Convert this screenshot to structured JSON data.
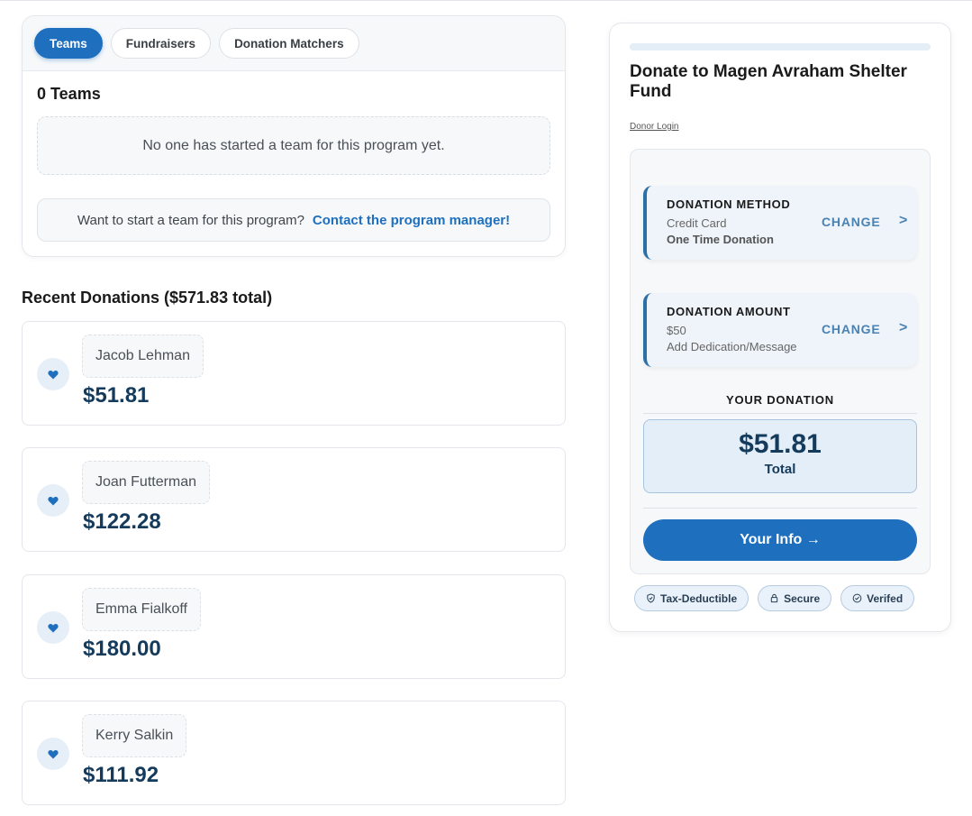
{
  "tabs": [
    {
      "label": "Teams",
      "active": true
    },
    {
      "label": "Fundraisers",
      "active": false
    },
    {
      "label": "Donation Matchers",
      "active": false
    }
  ],
  "teams": {
    "count_title": "0 Teams",
    "empty_message": "No one has started a team for this program yet.",
    "cta_text": "Want to start a team for this program?",
    "cta_link": "Contact the program manager!"
  },
  "recent": {
    "title": "Recent Donations ($571.83 total)",
    "donations": [
      {
        "name": "Jacob Lehman",
        "amount": "$51.81"
      },
      {
        "name": "Joan Futterman",
        "amount": "$122.28"
      },
      {
        "name": "Emma Fialkoff",
        "amount": "$180.00"
      },
      {
        "name": "Kerry Salkin",
        "amount": "$111.92"
      }
    ]
  },
  "donate": {
    "title": "Donate to Magen Avraham Shelter Fund",
    "donor_login": "Donor Login",
    "progress_fraction": 0,
    "method": {
      "label": "DONATION METHOD",
      "line1": "Credit Card",
      "line2": "One Time Donation",
      "change": "CHANGE",
      "chevron": ">"
    },
    "amount": {
      "label": "DONATION AMOUNT",
      "line1": "$50",
      "line2": "Add Dedication/Message",
      "change": "CHANGE",
      "chevron": ">"
    },
    "your_donation_label": "YOUR DONATION",
    "total_amount": "$51.81",
    "total_label": "Total",
    "info_button": "Your Info →",
    "badges": [
      {
        "label": "Tax-Deductible",
        "icon": "shield-icon"
      },
      {
        "label": "Secure",
        "icon": "lock-icon"
      },
      {
        "label": "Verifed",
        "icon": "check-circle-icon"
      }
    ]
  },
  "colors": {
    "primary": "#1f6fbf",
    "amount_text": "#153b5c",
    "heart": "#1f6fbf"
  }
}
